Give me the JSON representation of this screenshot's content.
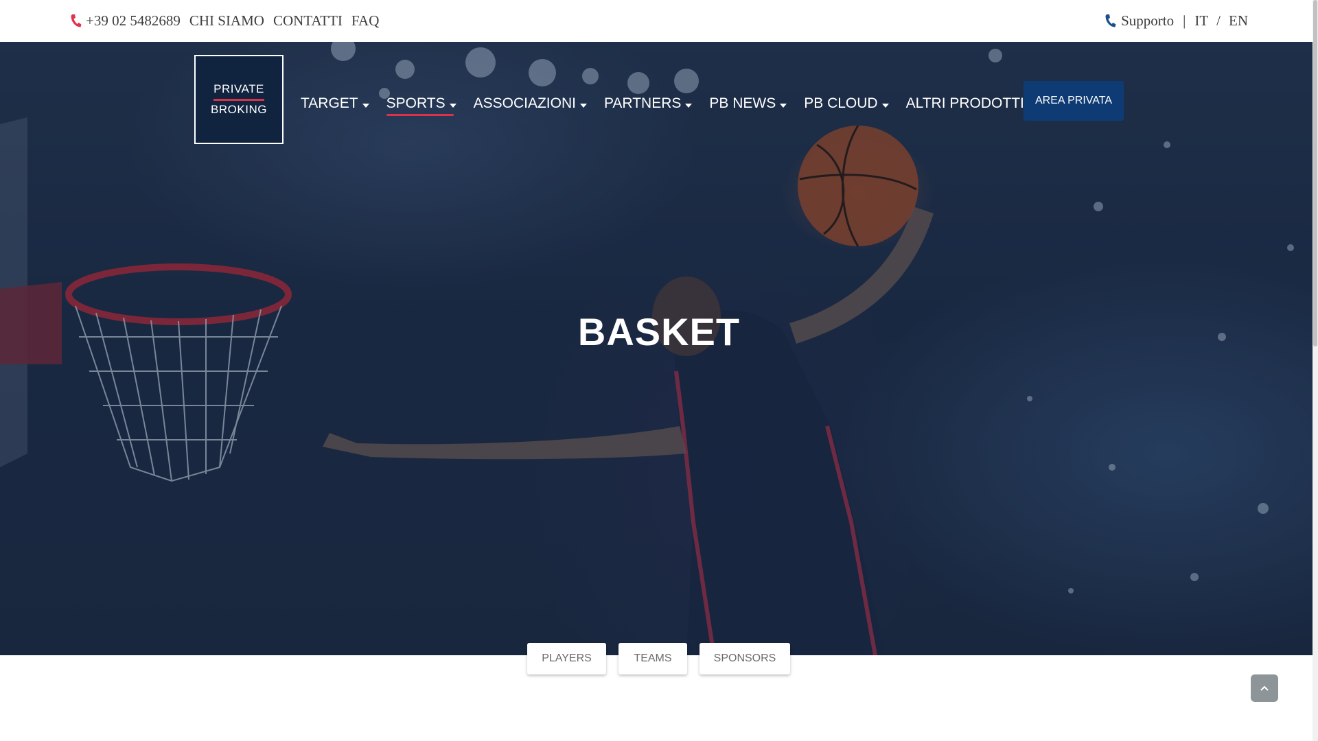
{
  "topbar": {
    "phone": "+39 02 5482689",
    "links": [
      "CHI SIAMO",
      "CONTATTI",
      "FAQ"
    ],
    "support": "Supporto",
    "separator": "|",
    "lang_it": "IT",
    "lang_slash": "/",
    "lang_en": "EN",
    "phone_icon_color": "#e0344b",
    "support_icon_color": "#1d4f8c"
  },
  "logo": {
    "line1": "PRIVATE",
    "line2": "BROKING",
    "accent_color": "#d9334a"
  },
  "nav": {
    "items": [
      {
        "label": "TARGET",
        "icon": "caret-down-icon"
      },
      {
        "label": "SPORTS",
        "icon": "caret-down-icon",
        "active": true
      },
      {
        "label": "ASSOCIAZIONI",
        "icon": "caret-down-icon"
      },
      {
        "label": "PARTNERS",
        "icon": "caret-down-icon"
      },
      {
        "label": "PB NEWS",
        "icon": "caret-down-icon"
      },
      {
        "label": "PB CLOUD",
        "icon": "caret-down-icon"
      },
      {
        "label": "ALTRI PRODOTTI",
        "icon": "caret-down-icon"
      }
    ],
    "area_privata": "AREA PRIVATA",
    "area_privata_color": "#0e3b73"
  },
  "hero": {
    "title": "BASKET"
  },
  "tabs": [
    "PLAYERS",
    "TEAMS",
    "SPONSORS"
  ],
  "back_to_top_icon": "chevron-up-icon"
}
